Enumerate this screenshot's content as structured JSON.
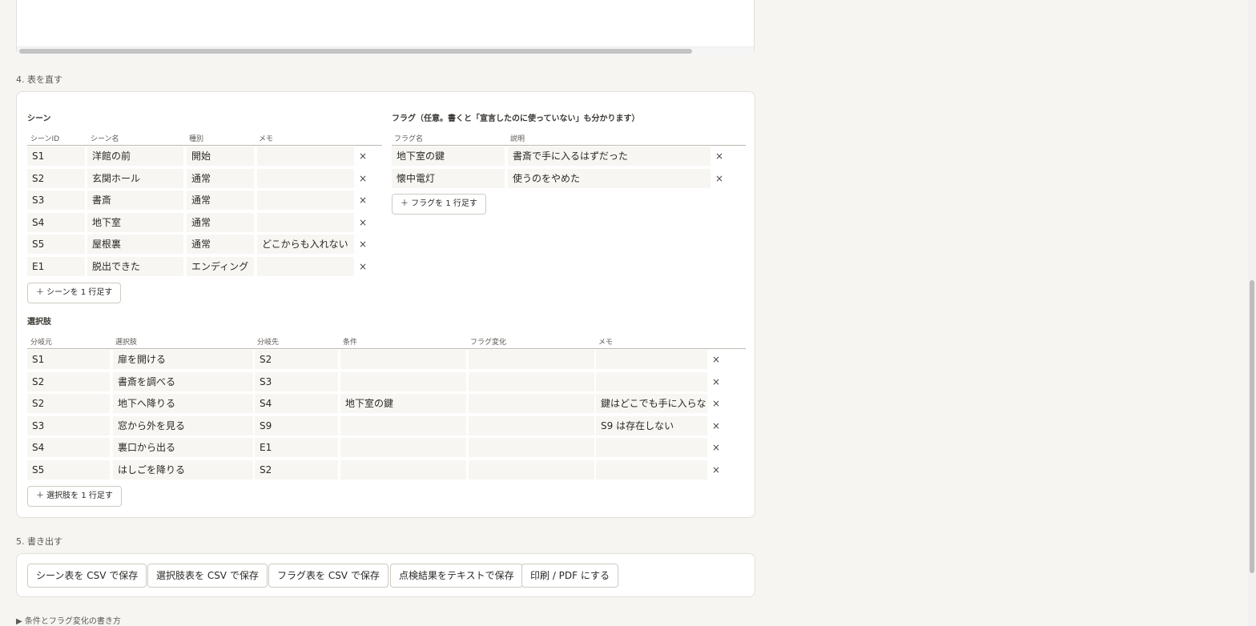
{
  "section4": {
    "title": "4. 表を直す",
    "scenes": {
      "title": "シーン",
      "headers": [
        "シーンID",
        "シーン名",
        "種別",
        "メモ"
      ],
      "rows": [
        {
          "id": "S1",
          "name": "洋館の前",
          "kind": "開始",
          "memo": ""
        },
        {
          "id": "S2",
          "name": "玄関ホール",
          "kind": "通常",
          "memo": ""
        },
        {
          "id": "S3",
          "name": "書斎",
          "kind": "通常",
          "memo": ""
        },
        {
          "id": "S4",
          "name": "地下室",
          "kind": "通常",
          "memo": ""
        },
        {
          "id": "S5",
          "name": "屋根裏",
          "kind": "通常",
          "memo": "どこからも入れない"
        },
        {
          "id": "E1",
          "name": "脱出できた",
          "kind": "エンディング",
          "memo": ""
        }
      ],
      "add_label": "＋ シーンを 1 行足す"
    },
    "flags": {
      "title": "フラグ（任意。書くと「宣言したのに使っていない」も分かります）",
      "headers": [
        "フラグ名",
        "説明"
      ],
      "rows": [
        {
          "name": "地下室の鍵",
          "desc": "書斎で手に入るはずだった"
        },
        {
          "name": "懐中電灯",
          "desc": "使うのをやめた"
        }
      ],
      "add_label": "＋ フラグを 1 行足す"
    },
    "choices": {
      "title": "選択肢",
      "headers": [
        "分岐元",
        "選択肢",
        "分岐先",
        "条件",
        "フラグ変化",
        "メモ"
      ],
      "rows": [
        {
          "from": "S1",
          "text": "扉を開ける",
          "to": "S2",
          "cond": "",
          "flag": "",
          "memo": ""
        },
        {
          "from": "S2",
          "text": "書斎を調べる",
          "to": "S3",
          "cond": "",
          "flag": "",
          "memo": ""
        },
        {
          "from": "S2",
          "text": "地下へ降りる",
          "to": "S4",
          "cond": "地下室の鍵",
          "flag": "",
          "memo": "鍵はどこでも手に入らない"
        },
        {
          "from": "S3",
          "text": "窓から外を見る",
          "to": "S9",
          "cond": "",
          "flag": "",
          "memo": "S9 は存在しない"
        },
        {
          "from": "S4",
          "text": "裏口から出る",
          "to": "E1",
          "cond": "",
          "flag": "",
          "memo": ""
        },
        {
          "from": "S5",
          "text": "はしごを降りる",
          "to": "S2",
          "cond": "",
          "flag": "",
          "memo": ""
        }
      ],
      "add_label": "＋ 選択肢を 1 行足す"
    },
    "delete_glyph": "×"
  },
  "section5": {
    "title": "5. 書き出す",
    "buttons": [
      "シーン表を CSV で保存",
      "選択肢表を CSV で保存",
      "フラグ表を CSV で保存",
      "点検結果をテキストで保存",
      "印刷 / PDF にする"
    ]
  },
  "details_label": "▶ 条件とフラグ変化の書き方"
}
